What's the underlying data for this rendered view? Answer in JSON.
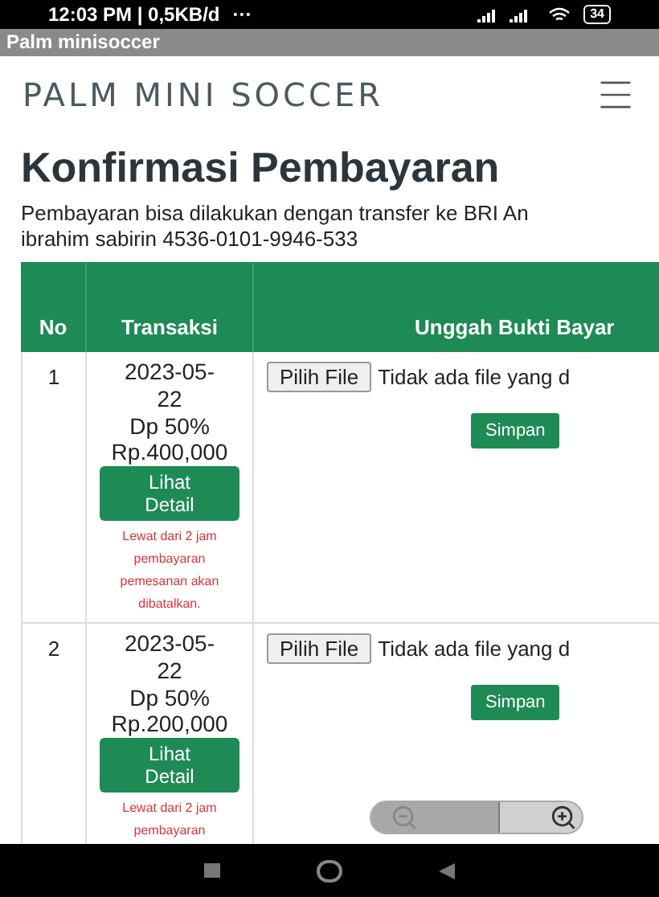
{
  "status_bar": {
    "time": "12:03 PM | 0,5KB/d",
    "dots": "···",
    "battery": "34"
  },
  "window": {
    "title": "Palm minisoccer"
  },
  "header": {
    "logo": "PALM MINI SOCCER"
  },
  "page": {
    "title": "Konfirmasi Pembayaran",
    "info": "Pembayaran bisa dilakukan dengan transfer ke BRI An ibrahim sabirin 4536-0101-9946-533"
  },
  "table": {
    "columns": [
      "No",
      "Transaksi",
      "Unggah Bukti Bayar"
    ],
    "rows": [
      {
        "no": "1",
        "date": "2023-05-22",
        "dp": "Dp 50%",
        "amount": "Rp.400,000",
        "detail_button": "Lihat Detail",
        "warning": "Lewat dari 2 jam pembayaran pemesanan akan dibatalkan.",
        "file_button": "Pilih File",
        "file_status": "Tidak ada file yang d",
        "save_button": "Simpan"
      },
      {
        "no": "2",
        "date": "2023-05-22",
        "dp": "Dp 50%",
        "amount": "Rp.200,000",
        "detail_button": "Lihat Detail",
        "warning": "Lewat dari 2 jam pembayaran",
        "file_button": "Pilih File",
        "file_status": "Tidak ada file yang d",
        "save_button": "Simpan"
      }
    ]
  }
}
